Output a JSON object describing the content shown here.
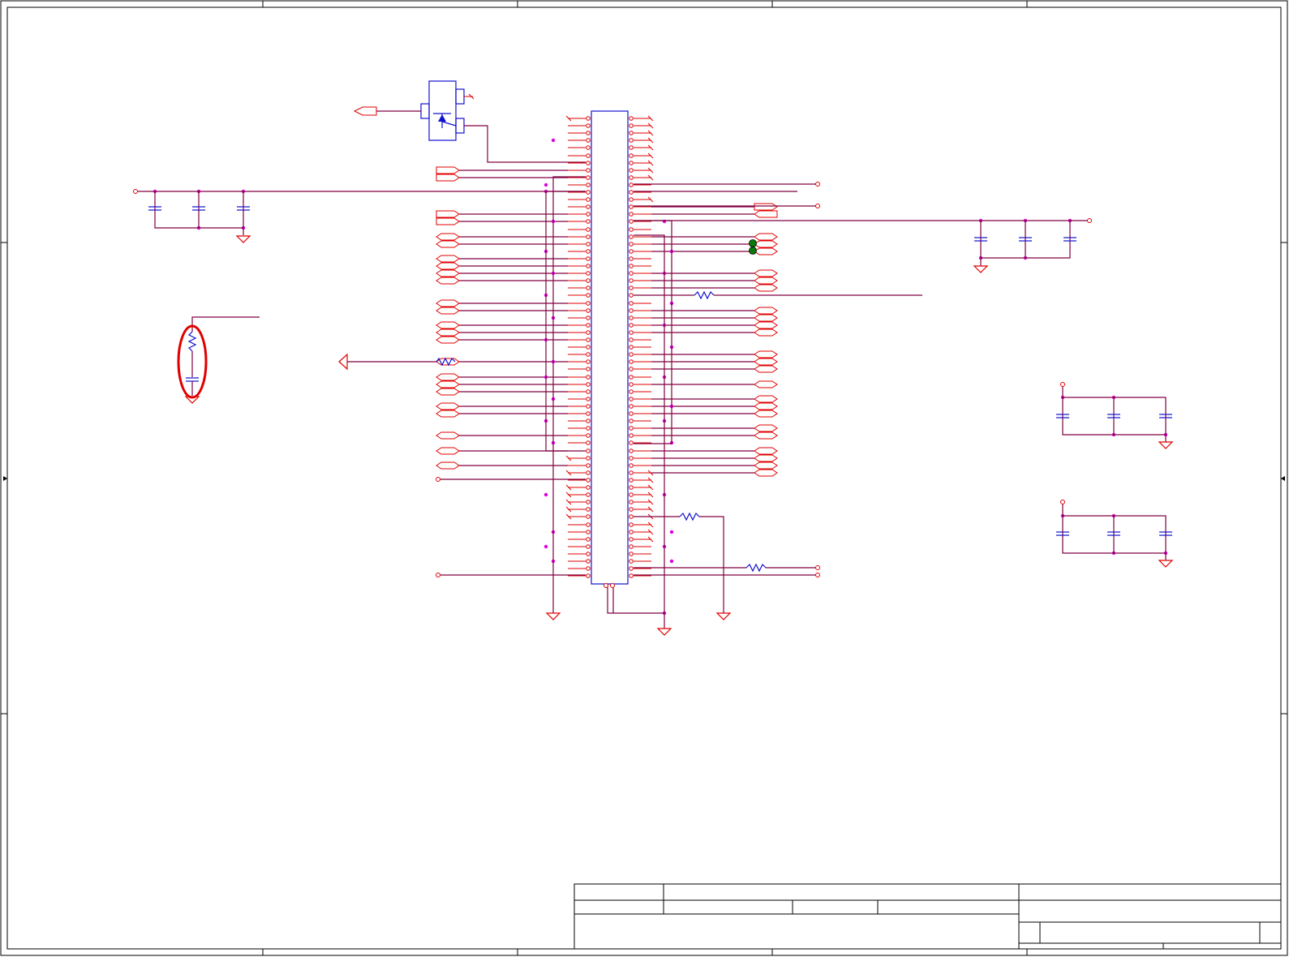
{
  "sheet": {
    "width_label": "",
    "title_block": {
      "title": "",
      "document_number": "",
      "revision": "",
      "date": "",
      "sheet": ""
    }
  },
  "colors": {
    "wire": "#800040",
    "pin": "#e00000",
    "component": "#1010d0",
    "junction": "#e000e0",
    "highlight": "#e00000",
    "testpoint": "#0a7a0a"
  },
  "annotations": {
    "highlight": "red-ellipse-around-rc-network"
  }
}
